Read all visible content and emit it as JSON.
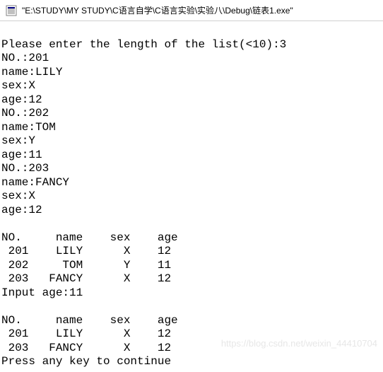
{
  "window": {
    "title": "\"E:\\STUDY\\MY STUDY\\C语言自学\\C语言实验\\实验八\\Debug\\链表1.exe\""
  },
  "console": {
    "prompt_length": "Please enter the length of the list(<10):3",
    "entries": [
      {
        "no_label": "NO.:201",
        "name_label": "name:LILY",
        "sex_label": "sex:X",
        "age_label": "age:12"
      },
      {
        "no_label": "NO.:202",
        "name_label": "name:TOM",
        "sex_label": "sex:Y",
        "age_label": "age:11"
      },
      {
        "no_label": "NO.:203",
        "name_label": "name:FANCY",
        "sex_label": "sex:X",
        "age_label": "age:12"
      }
    ],
    "table1": {
      "header": "NO.     name    sex    age",
      "rows": [
        " 201    LILY      X    12",
        " 202     TOM      Y    11",
        " 203   FANCY      X    12"
      ]
    },
    "input_age": "Input age:11",
    "table2": {
      "header": "NO.     name    sex    age",
      "rows": [
        " 201    LILY      X    12",
        " 203   FANCY      X    12"
      ]
    },
    "press_key": "Press any key to continue"
  },
  "watermark": "https://blog.csdn.net/weixin_44410704"
}
